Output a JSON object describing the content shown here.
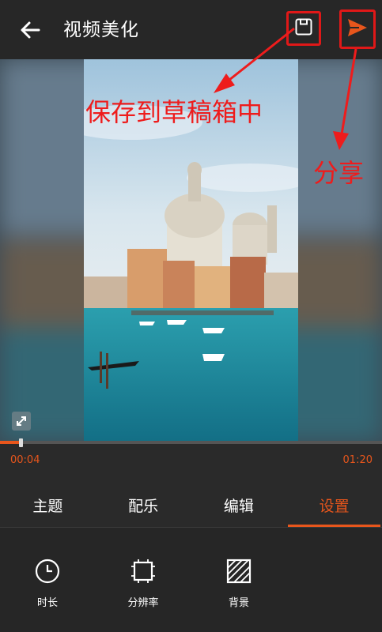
{
  "header": {
    "title": "视频美化",
    "back_icon": "back-arrow-icon",
    "save_icon": "save-icon",
    "share_icon": "send-icon"
  },
  "annotations": {
    "save_label": "保存到草稿箱中",
    "share_label": "分享"
  },
  "player": {
    "current_time": "00:04",
    "total_time": "01:20",
    "progress_fraction": 0.05,
    "expand_icon": "expand-icon"
  },
  "tabs": [
    {
      "label": "主题",
      "active": false
    },
    {
      "label": "配乐",
      "active": false
    },
    {
      "label": "编辑",
      "active": false
    },
    {
      "label": "设置",
      "active": true
    }
  ],
  "tools": [
    {
      "label": "时长",
      "icon": "clock-icon"
    },
    {
      "label": "分辨率",
      "icon": "resolution-icon"
    },
    {
      "label": "背景",
      "icon": "background-pattern-icon"
    }
  ],
  "colors": {
    "accent": "#e8561c",
    "annotation": "#ee1c1c",
    "bar_bg": "#272727"
  }
}
